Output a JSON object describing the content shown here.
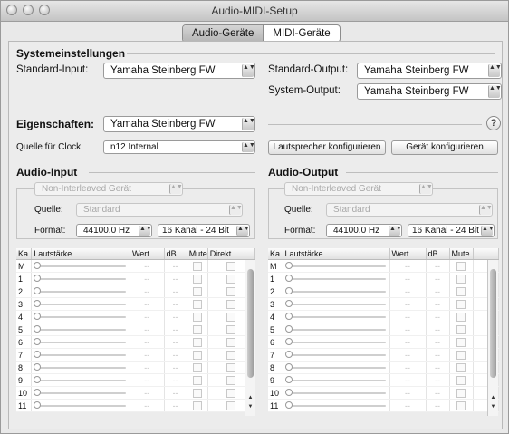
{
  "window": {
    "title": "Audio-MIDI-Setup"
  },
  "tabs": [
    {
      "label": "Audio-Geräte",
      "active": true
    },
    {
      "label": "MIDI-Geräte",
      "active": false
    }
  ],
  "system": {
    "heading": "Systemeinstellungen",
    "input_label": "Standard-Input:",
    "input_value": "Yamaha Steinberg FW",
    "output_label": "Standard-Output:",
    "output_value": "Yamaha Steinberg FW",
    "sysout_label": "System-Output:",
    "sysout_value": "Yamaha Steinberg FW"
  },
  "properties": {
    "label": "Eigenschaften:",
    "value": "Yamaha Steinberg FW",
    "help": "?",
    "clock_label": "Quelle für Clock:",
    "clock_value": "n12 Internal",
    "speaker_button": "Lautsprecher konfigurieren",
    "device_button": "Gerät konfigurieren"
  },
  "audio_input": {
    "heading": "Audio-Input",
    "interleave": "Non-Interleaved Gerät",
    "source_label": "Quelle:",
    "source_value": "Standard",
    "format_label": "Format:",
    "rate": "44100.0 Hz",
    "channels": "16 Kanal - 24 Bit",
    "columns": [
      "Ka",
      "Lautstärke",
      "Wert",
      "dB",
      "Mute",
      "Direkt"
    ],
    "rows": [
      "M",
      "1",
      "2",
      "3",
      "4",
      "5",
      "6",
      "7",
      "8",
      "9",
      "10",
      "11"
    ]
  },
  "audio_output": {
    "heading": "Audio-Output",
    "interleave": "Non-Interleaved Gerät",
    "source_label": "Quelle:",
    "source_value": "Standard",
    "format_label": "Format:",
    "rate": "44100.0 Hz",
    "channels": "16 Kanal - 24 Bit",
    "columns": [
      "Ka",
      "Lautstärke",
      "Wert",
      "dB",
      "Mute"
    ],
    "rows": [
      "M",
      "1",
      "2",
      "3",
      "4",
      "5",
      "6",
      "7",
      "8",
      "9",
      "10",
      "11"
    ]
  },
  "placeholders": {
    "dash": "--",
    "popup_arrows": "▲▼"
  }
}
